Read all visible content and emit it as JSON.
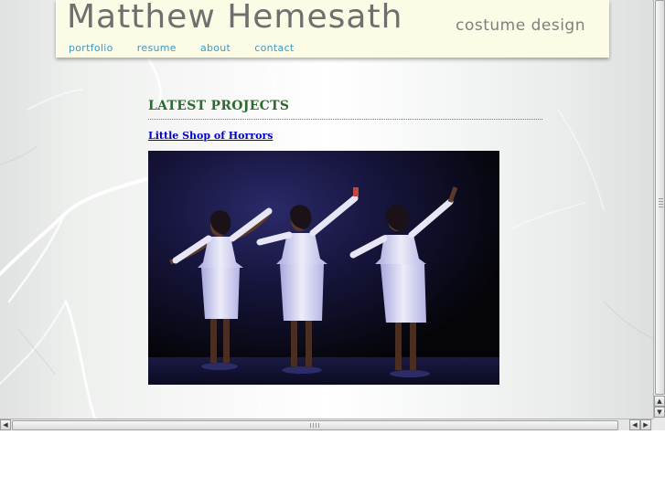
{
  "header": {
    "title": "Matthew Hemesath",
    "tagline": "costume design"
  },
  "nav": {
    "items": [
      {
        "label": "portfolio"
      },
      {
        "label": "resume"
      },
      {
        "label": "about"
      },
      {
        "label": "contact"
      }
    ]
  },
  "main": {
    "section_heading": "LATEST PROJECTS",
    "project_link": "Little Shop of Horrors"
  },
  "scrollbars": {
    "left_arrow": "◀",
    "right_arrow": "▶",
    "up_arrow": "▲",
    "down_arrow": "▼"
  },
  "colors": {
    "header_bg": "#fcfce6",
    "heading_green": "#2e6a2f",
    "nav_blue": "#3a9ac7",
    "link_blue": "#0000cc"
  }
}
